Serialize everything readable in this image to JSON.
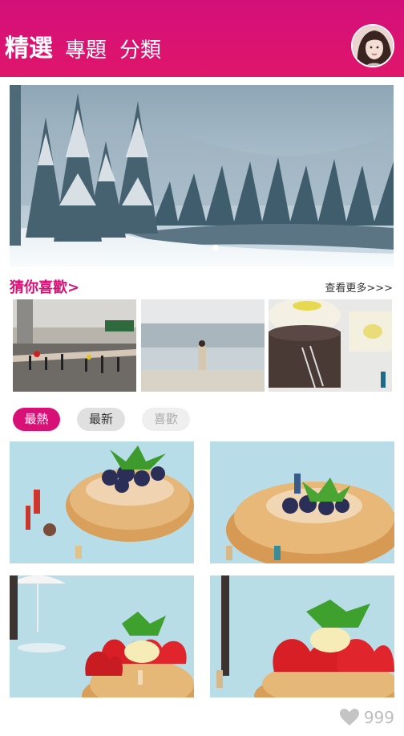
{
  "header": {
    "tabs": [
      {
        "label": "精選",
        "active": true
      },
      {
        "label": "專題",
        "active": false
      },
      {
        "label": "分類",
        "active": false
      }
    ],
    "color": "#d81176"
  },
  "banner": {
    "slide_count": 1,
    "active_index": 0
  },
  "recommend": {
    "title": "猜你喜歡>",
    "see_more": "查看更多>>>"
  },
  "filters": [
    {
      "label": "最熱",
      "active": true
    },
    {
      "label": "最新",
      "active": false
    },
    {
      "label": "喜歡",
      "active": false
    }
  ],
  "like": {
    "icon": "heart-icon",
    "count": "999"
  }
}
